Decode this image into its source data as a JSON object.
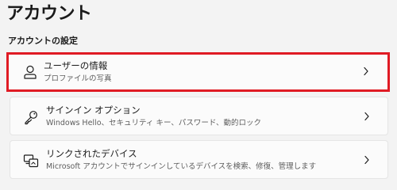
{
  "page": {
    "title": "アカウント",
    "section_title": "アカウントの設定"
  },
  "items": [
    {
      "label": "ユーザーの情報",
      "description": "プロファイルの写真",
      "icon": "person-icon",
      "highlighted": true
    },
    {
      "label": "サインイン オプション",
      "description": "Windows Hello、セキュリティ キー、パスワード、動的ロック",
      "icon": "key-icon",
      "highlighted": false
    },
    {
      "label": "リンクされたデバイス",
      "description": "Microsoft アカウントでサインインしているデバイスを検索、修復、管理します",
      "icon": "linked-devices-icon",
      "highlighted": false
    }
  ],
  "colors": {
    "highlight_border": "#e01b24",
    "background": "#f3f3f3",
    "card_background": "#fbfbfb"
  }
}
